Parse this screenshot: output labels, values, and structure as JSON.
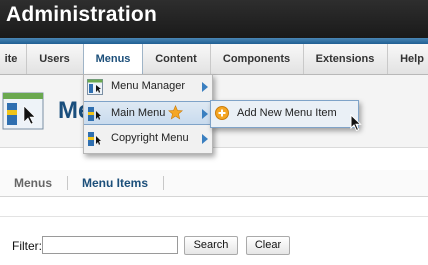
{
  "header": {
    "title": "Administration"
  },
  "menubar": {
    "items": [
      {
        "label": "ite"
      },
      {
        "label": "Users"
      },
      {
        "label": "Menus"
      },
      {
        "label": "Content"
      },
      {
        "label": "Components"
      },
      {
        "label": "Extensions"
      },
      {
        "label": "Help"
      }
    ]
  },
  "page": {
    "title": "Menus"
  },
  "menus_dropdown": {
    "items": [
      {
        "label": "Menu Manager",
        "icon": "menu-manager-icon"
      },
      {
        "label": "Main Menu",
        "icon": "menu-icon",
        "badge": "default-star-icon"
      },
      {
        "label": "Copyright Menu",
        "icon": "menu-icon"
      }
    ]
  },
  "submenu": {
    "item": {
      "label": "Add New Menu Item",
      "icon": "add-icon"
    }
  },
  "subnav": {
    "tabs": [
      {
        "label": "Menus"
      },
      {
        "label": "Menu Items"
      }
    ]
  },
  "filter": {
    "label": "Filter:",
    "value": "",
    "search_label": "Search",
    "clear_label": "Clear"
  },
  "colors": {
    "accent": "#1a4e7c",
    "highlight": "#c9dbee",
    "arrow": "#3a7fc0",
    "star": "#f5a623"
  }
}
